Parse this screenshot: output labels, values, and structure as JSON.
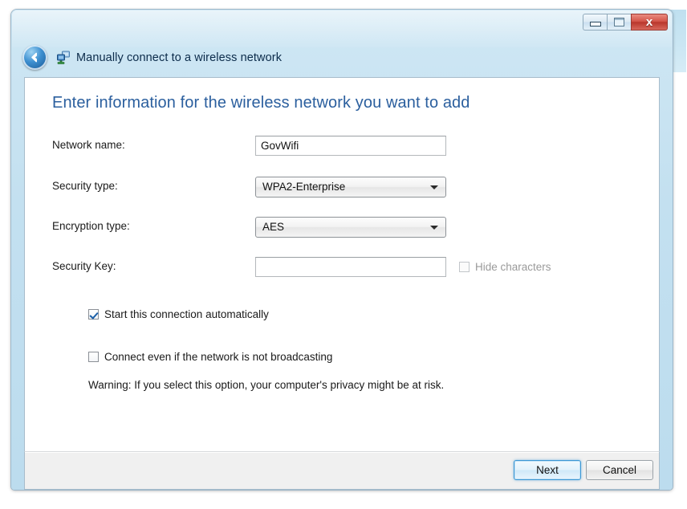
{
  "window": {
    "title": "Manually connect to a wireless network",
    "title_icon": "network-computer-icon",
    "back_button_icon": "back-arrow-icon",
    "controls": {
      "minimize_label": "–",
      "maximize_label": "□",
      "close_label": "x"
    }
  },
  "main": {
    "heading": "Enter information for the wireless network you want to add",
    "fields": [
      {
        "label": "Network name:",
        "type": "text",
        "value": "GovWifi",
        "placeholder": ""
      },
      {
        "label": "Security type:",
        "type": "combobox",
        "value": "WPA2-Enterprise"
      },
      {
        "label": "Encryption type:",
        "type": "combobox",
        "value": "AES"
      },
      {
        "label": "Security Key:",
        "type": "text",
        "value": "",
        "placeholder": ""
      }
    ],
    "hide_characters": {
      "label": "Hide characters",
      "checked": false,
      "disabled": true
    },
    "checkboxes": [
      {
        "label": "Start this connection automatically",
        "checked": true
      },
      {
        "label": "Connect even if the network is not broadcasting",
        "checked": false
      }
    ],
    "warning": "Warning: If you select this option, your computer's privacy might be at risk."
  },
  "footer": {
    "next_label": "Next",
    "cancel_label": "Cancel"
  },
  "colors": {
    "heading_blue": "#2b5f9e",
    "frame_blue": "#c3e0f0",
    "close_red": "#c2453a",
    "focus_blue": "#3c97d4",
    "check_blue": "#1b5fa8"
  }
}
